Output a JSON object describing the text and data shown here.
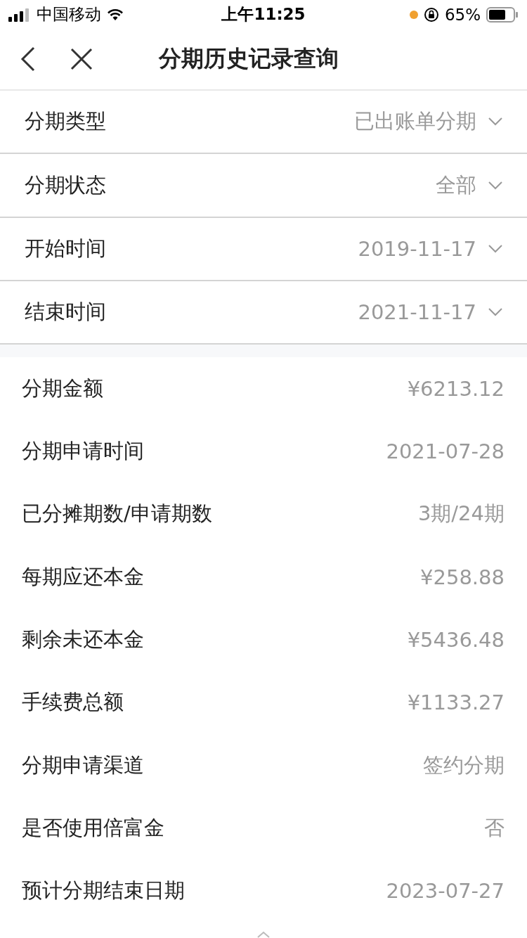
{
  "status_bar": {
    "carrier": "中国移动",
    "time": "上午11:25",
    "battery": "65%"
  },
  "nav": {
    "title": "分期历史记录查询"
  },
  "filters": [
    {
      "label": "分期类型",
      "value": "已出账单分期"
    },
    {
      "label": "分期状态",
      "value": "全部"
    },
    {
      "label": "开始时间",
      "value": "2019-11-17"
    },
    {
      "label": "结束时间",
      "value": "2021-11-17"
    }
  ],
  "details": [
    {
      "label": "分期金额",
      "value": "¥6213.12"
    },
    {
      "label": "分期申请时间",
      "value": "2021-07-28"
    },
    {
      "label": "已分摊期数/申请期数",
      "value": "3期/24期"
    },
    {
      "label": "每期应还本金",
      "value": "¥258.88"
    },
    {
      "label": "剩余未还本金",
      "value": "¥5436.48"
    },
    {
      "label": "手续费总额",
      "value": "¥1133.27"
    },
    {
      "label": "分期申请渠道",
      "value": "签约分期"
    },
    {
      "label": "是否使用倍富金",
      "value": "否"
    },
    {
      "label": "预计分期结束日期",
      "value": "2023-07-27"
    }
  ]
}
